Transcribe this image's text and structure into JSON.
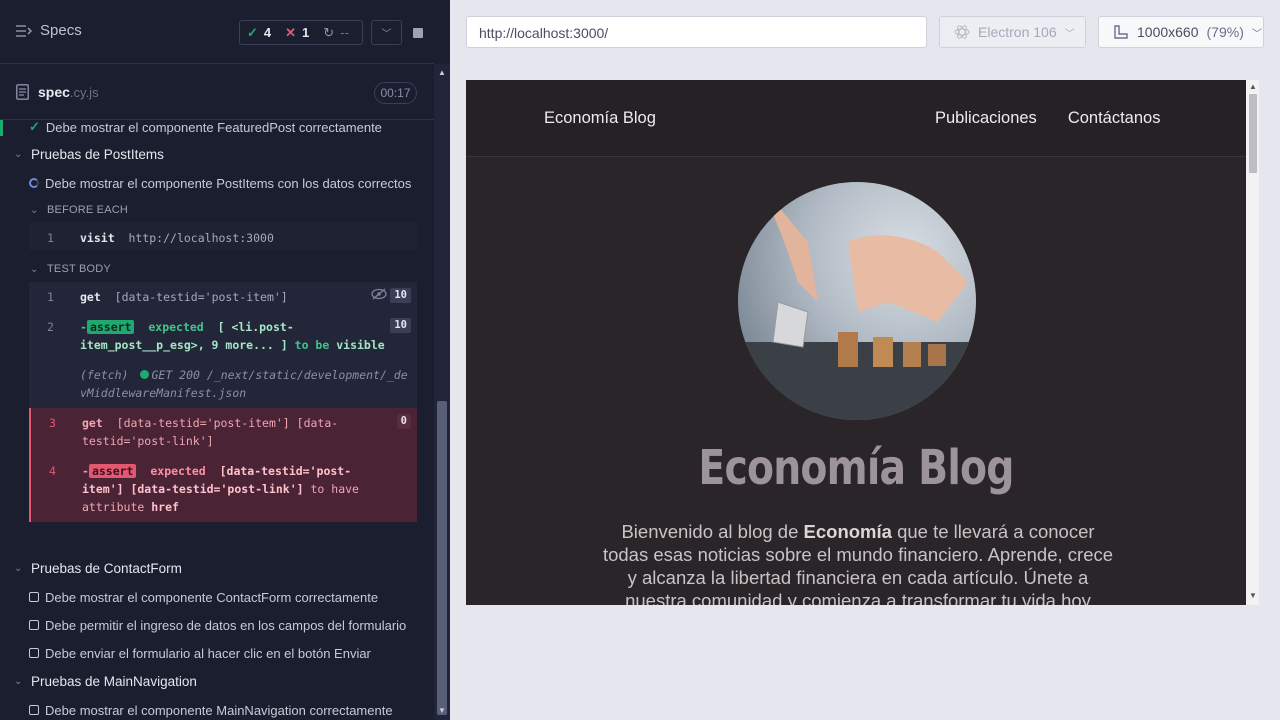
{
  "header": {
    "specs_title": "Specs",
    "passed": "4",
    "failed": "1",
    "pending": "--"
  },
  "spec": {
    "name": "spec",
    "ext": ".cy.js",
    "duration": "00:17"
  },
  "tests": {
    "featured_test": "Debe mostrar el componente FeaturedPost correctamente",
    "suite_postitems": "Pruebas de PostItems",
    "postitems_test": "Debe mostrar el componente PostItems con los datos correctos",
    "before_each": "BEFORE EACH",
    "test_body": "TEST BODY",
    "suite_contactform": "Pruebas de ContactForm",
    "contact_test_1": "Debe mostrar el componente ContactForm correctamente",
    "contact_test_2": "Debe permitir el ingreso de datos en los campos del formulario",
    "contact_test_3": "Debe enviar el formulario al hacer clic en el botón Enviar",
    "suite_mainnav": "Pruebas de MainNavigation",
    "mainnav_test": "Debe mostrar el componente MainNavigation correctamente"
  },
  "commands": {
    "before": {
      "num": "1",
      "name": "visit",
      "arg": "http://localhost:3000"
    },
    "c1": {
      "num": "1",
      "name": "get",
      "arg": "[data-testid='post-item']",
      "count": "10"
    },
    "c2": {
      "num": "2",
      "dash": "-",
      "tag": "assert",
      "word": "expected",
      "subject": "[ <li.post-item_post__p_esg>, 9 more... ]",
      "rest": "to be",
      "rest2": "visible",
      "count": "10"
    },
    "fetch": {
      "label": "(fetch)",
      "status": "GET 200",
      "path": "/_next/static/development/_devMiddlewareManifest.json"
    },
    "c3": {
      "num": "3",
      "name": "get",
      "arg": "[data-testid='post-item'] [data-testid='post-link']",
      "count": "0"
    },
    "c4": {
      "num": "4",
      "dash": "-",
      "tag": "assert",
      "word": "expected",
      "subject": "[data-testid='post-item'] [data-testid='post-link']",
      "rest": "to have attribute",
      "rest2": "href"
    }
  },
  "browser": {
    "url": "http://localhost:3000/",
    "engine": "Electron 106",
    "viewport": "1000x660",
    "zoom": "(79%)"
  },
  "site": {
    "brand": "Economía Blog",
    "nav": [
      "Publicaciones",
      "Contáctanos"
    ],
    "hero_title": "Economía Blog",
    "hero_p1": "Bienvenido al blog de ",
    "hero_bold": "Economía",
    "hero_p2": " que te llevará a conocer todas esas noticias sobre el mundo financiero. Aprende, crece y alcanza la libertad financiera en cada artículo. Únete a nuestra comunidad y comienza a transformar tu vida hoy"
  }
}
